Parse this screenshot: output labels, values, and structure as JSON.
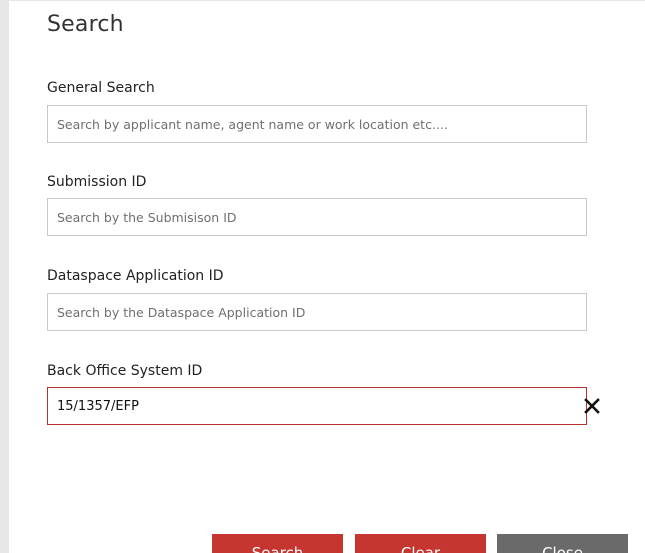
{
  "dialog": {
    "title": "Search"
  },
  "fields": [
    {
      "label": "General Search",
      "placeholder": "Search by applicant name, agent name or work location etc....",
      "value": ""
    },
    {
      "label": "Submission ID",
      "placeholder": "Search by the Submisison ID",
      "value": ""
    },
    {
      "label": "Dataspace Application ID",
      "placeholder": "Search by the Dataspace Application ID",
      "value": ""
    },
    {
      "label": "Back Office System ID",
      "placeholder": "",
      "value": "15/1357/EFP"
    }
  ],
  "icons": {
    "clear_field": "close-icon"
  },
  "buttons": {
    "search": "Search",
    "clear": "Clear",
    "close": "Close"
  },
  "colors": {
    "primary_button": "#c4362f",
    "secondary_button": "#6a6a6a",
    "active_border": "#b3322b"
  }
}
